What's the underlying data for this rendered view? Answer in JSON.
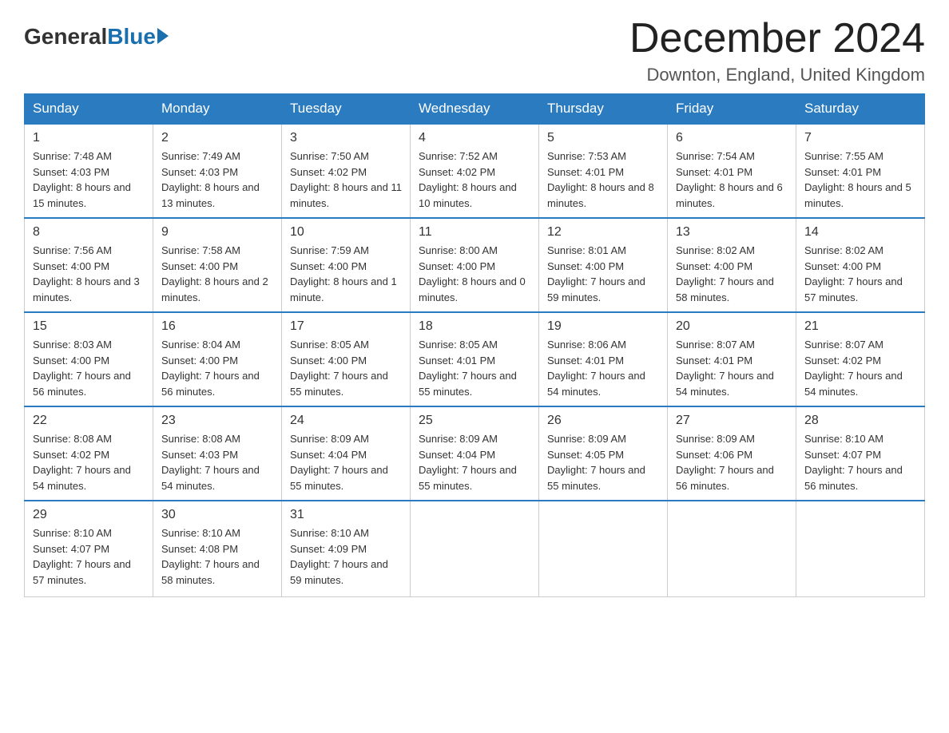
{
  "header": {
    "logo": {
      "general": "General",
      "blue": "Blue"
    },
    "title": "December 2024",
    "location": "Downton, England, United Kingdom"
  },
  "weekdays": [
    "Sunday",
    "Monday",
    "Tuesday",
    "Wednesday",
    "Thursday",
    "Friday",
    "Saturday"
  ],
  "weeks": [
    [
      {
        "day": "1",
        "sunrise": "7:48 AM",
        "sunset": "4:03 PM",
        "daylight": "8 hours and 15 minutes."
      },
      {
        "day": "2",
        "sunrise": "7:49 AM",
        "sunset": "4:03 PM",
        "daylight": "8 hours and 13 minutes."
      },
      {
        "day": "3",
        "sunrise": "7:50 AM",
        "sunset": "4:02 PM",
        "daylight": "8 hours and 11 minutes."
      },
      {
        "day": "4",
        "sunrise": "7:52 AM",
        "sunset": "4:02 PM",
        "daylight": "8 hours and 10 minutes."
      },
      {
        "day": "5",
        "sunrise": "7:53 AM",
        "sunset": "4:01 PM",
        "daylight": "8 hours and 8 minutes."
      },
      {
        "day": "6",
        "sunrise": "7:54 AM",
        "sunset": "4:01 PM",
        "daylight": "8 hours and 6 minutes."
      },
      {
        "day": "7",
        "sunrise": "7:55 AM",
        "sunset": "4:01 PM",
        "daylight": "8 hours and 5 minutes."
      }
    ],
    [
      {
        "day": "8",
        "sunrise": "7:56 AM",
        "sunset": "4:00 PM",
        "daylight": "8 hours and 3 minutes."
      },
      {
        "day": "9",
        "sunrise": "7:58 AM",
        "sunset": "4:00 PM",
        "daylight": "8 hours and 2 minutes."
      },
      {
        "day": "10",
        "sunrise": "7:59 AM",
        "sunset": "4:00 PM",
        "daylight": "8 hours and 1 minute."
      },
      {
        "day": "11",
        "sunrise": "8:00 AM",
        "sunset": "4:00 PM",
        "daylight": "8 hours and 0 minutes."
      },
      {
        "day": "12",
        "sunrise": "8:01 AM",
        "sunset": "4:00 PM",
        "daylight": "7 hours and 59 minutes."
      },
      {
        "day": "13",
        "sunrise": "8:02 AM",
        "sunset": "4:00 PM",
        "daylight": "7 hours and 58 minutes."
      },
      {
        "day": "14",
        "sunrise": "8:02 AM",
        "sunset": "4:00 PM",
        "daylight": "7 hours and 57 minutes."
      }
    ],
    [
      {
        "day": "15",
        "sunrise": "8:03 AM",
        "sunset": "4:00 PM",
        "daylight": "7 hours and 56 minutes."
      },
      {
        "day": "16",
        "sunrise": "8:04 AM",
        "sunset": "4:00 PM",
        "daylight": "7 hours and 56 minutes."
      },
      {
        "day": "17",
        "sunrise": "8:05 AM",
        "sunset": "4:00 PM",
        "daylight": "7 hours and 55 minutes."
      },
      {
        "day": "18",
        "sunrise": "8:05 AM",
        "sunset": "4:01 PM",
        "daylight": "7 hours and 55 minutes."
      },
      {
        "day": "19",
        "sunrise": "8:06 AM",
        "sunset": "4:01 PM",
        "daylight": "7 hours and 54 minutes."
      },
      {
        "day": "20",
        "sunrise": "8:07 AM",
        "sunset": "4:01 PM",
        "daylight": "7 hours and 54 minutes."
      },
      {
        "day": "21",
        "sunrise": "8:07 AM",
        "sunset": "4:02 PM",
        "daylight": "7 hours and 54 minutes."
      }
    ],
    [
      {
        "day": "22",
        "sunrise": "8:08 AM",
        "sunset": "4:02 PM",
        "daylight": "7 hours and 54 minutes."
      },
      {
        "day": "23",
        "sunrise": "8:08 AM",
        "sunset": "4:03 PM",
        "daylight": "7 hours and 54 minutes."
      },
      {
        "day": "24",
        "sunrise": "8:09 AM",
        "sunset": "4:04 PM",
        "daylight": "7 hours and 55 minutes."
      },
      {
        "day": "25",
        "sunrise": "8:09 AM",
        "sunset": "4:04 PM",
        "daylight": "7 hours and 55 minutes."
      },
      {
        "day": "26",
        "sunrise": "8:09 AM",
        "sunset": "4:05 PM",
        "daylight": "7 hours and 55 minutes."
      },
      {
        "day": "27",
        "sunrise": "8:09 AM",
        "sunset": "4:06 PM",
        "daylight": "7 hours and 56 minutes."
      },
      {
        "day": "28",
        "sunrise": "8:10 AM",
        "sunset": "4:07 PM",
        "daylight": "7 hours and 56 minutes."
      }
    ],
    [
      {
        "day": "29",
        "sunrise": "8:10 AM",
        "sunset": "4:07 PM",
        "daylight": "7 hours and 57 minutes."
      },
      {
        "day": "30",
        "sunrise": "8:10 AM",
        "sunset": "4:08 PM",
        "daylight": "7 hours and 58 minutes."
      },
      {
        "day": "31",
        "sunrise": "8:10 AM",
        "sunset": "4:09 PM",
        "daylight": "7 hours and 59 minutes."
      },
      null,
      null,
      null,
      null
    ]
  ]
}
